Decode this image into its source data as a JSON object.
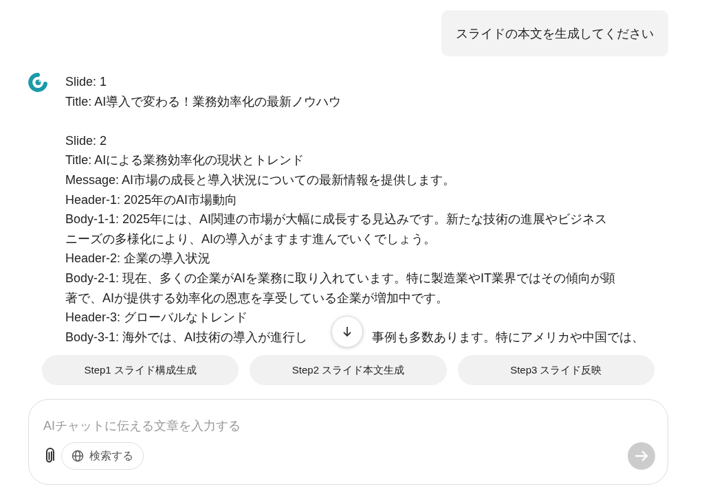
{
  "user_message": {
    "text": "スライドの本文を生成してください"
  },
  "assistant_message": {
    "paragraphs": [
      {
        "lines": [
          {
            "text": "Slide: 1"
          },
          {
            "text": "Title: AI導入で変わる！業務効率化の最新ノウハウ"
          }
        ]
      },
      {
        "lines": [
          {
            "text": "Slide: 2"
          },
          {
            "text": "Title: AIによる業務効率化の現状とトレンド"
          },
          {
            "text": "Message: AI市場の成長と導入状況についての最新情報を提供します。"
          },
          {
            "text": "Header-1: 2025年のAI市場動向"
          },
          {
            "text": "Body-1-1: 2025年には、AI関連の市場が大幅に成長する見込みです。新たな技術の進展やビジネス"
          },
          {
            "text": "ニーズの多様化により、AIの導入がますます進んでいくでしょう。"
          },
          {
            "text": "Header-2: 企業の導入状況"
          },
          {
            "text": "Body-2-1: 現在、多くの企業がAIを業務に取り入れています。特に製造業やIT業界ではその傾向が顕"
          },
          {
            "text": "著で、AIが提供する効率化の恩恵を享受している企業が増加中です。"
          },
          {
            "text": "Header-3: グローバルなトレンド"
          },
          {
            "text": "Body-3-1: 海外では、AI技術の導入が進行し",
            "continuation": "事例も多数あります。特にアメリカや中国では、"
          }
        ]
      }
    ]
  },
  "step_buttons": [
    {
      "label": "Step1 スライド構成生成"
    },
    {
      "label": "Step2 スライド本文生成"
    },
    {
      "label": "Step3 スライド反映"
    }
  ],
  "composer": {
    "placeholder": "AIチャットに伝える文章を入力する",
    "search_button": {
      "label": "検索する"
    },
    "send_disabled": true
  }
}
